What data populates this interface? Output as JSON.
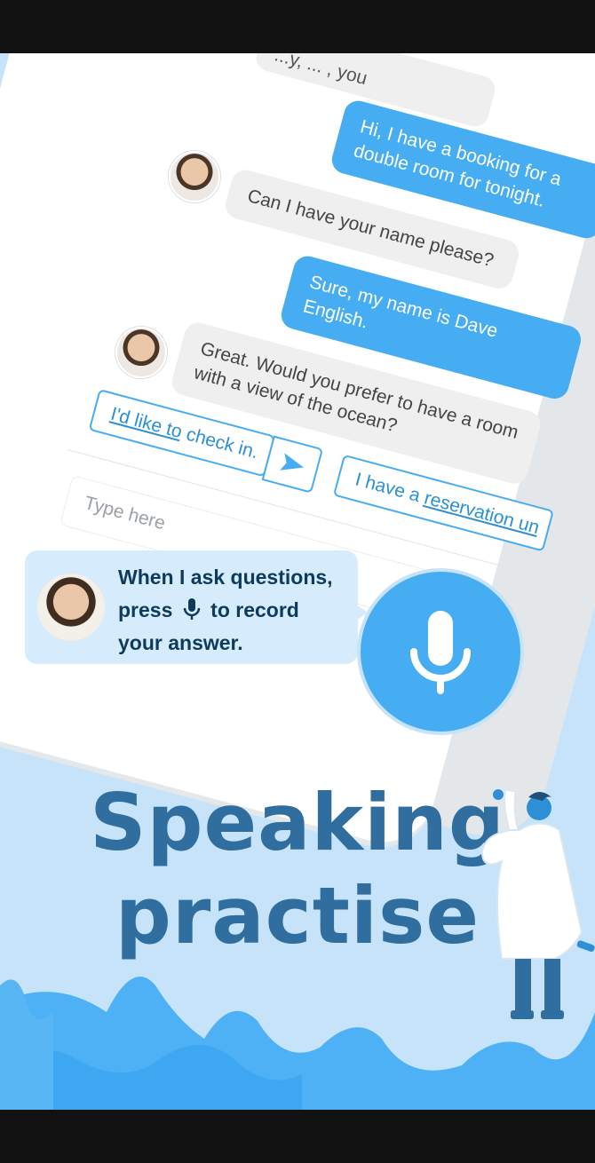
{
  "chat": {
    "partial_bubble_text": "...y, ... , you",
    "messages": [
      {
        "from": "me",
        "text": "Hi, I have a booking for a double room for tonight."
      },
      {
        "from": "them",
        "text": "Can I have your name please?"
      },
      {
        "from": "me",
        "text": "Sure, my name is Dave English."
      },
      {
        "from": "them",
        "text": "Great. Would you prefer to have a room with a view of the ocean?"
      }
    ],
    "suggestions": [
      {
        "pre": "",
        "link": "I'd like to",
        "post": " check in."
      },
      {
        "pre": "I have a ",
        "link": "reservation un",
        "post": ""
      }
    ],
    "input_placeholder": "Type here"
  },
  "tooltip": {
    "line1": "When I ask questions,",
    "line2_pre": "press",
    "line2_post": "to record",
    "line3": "your answer."
  },
  "headline": {
    "line1": "Speaking",
    "line2": "practise"
  },
  "colors": {
    "accent": "#47adf2",
    "background": "#c6e3f9",
    "headline": "#2f6e9e",
    "tooltip_text": "#0e3a5c"
  },
  "icons": [
    "mic-icon",
    "send-icon",
    "mic-inline-icon"
  ]
}
